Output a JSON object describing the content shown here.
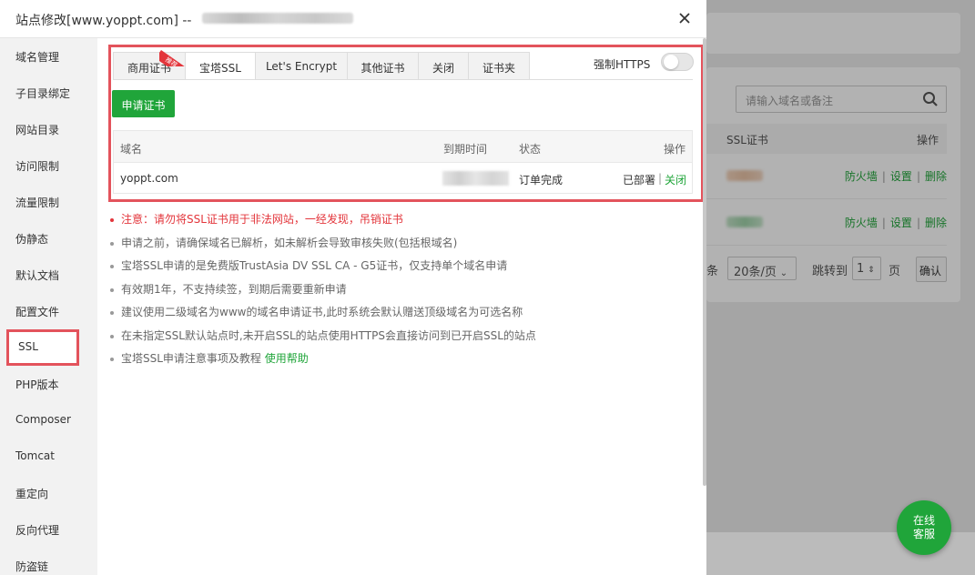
{
  "modal": {
    "title": "站点修改[www.yoppt.com] --",
    "close_icon": "close-icon"
  },
  "sidebar": {
    "items": [
      {
        "label": "域名管理"
      },
      {
        "label": "子目录绑定"
      },
      {
        "label": "网站目录"
      },
      {
        "label": "访问限制"
      },
      {
        "label": "流量限制"
      },
      {
        "label": "伪静态"
      },
      {
        "label": "默认文档"
      },
      {
        "label": "配置文件"
      },
      {
        "label": "SSL",
        "active": true
      },
      {
        "label": "PHP版本"
      },
      {
        "label": "Composer"
      },
      {
        "label": "Tomcat"
      },
      {
        "label": "重定向"
      },
      {
        "label": "反向代理"
      },
      {
        "label": "防盗链"
      }
    ]
  },
  "ssl": {
    "tabs": [
      {
        "label": "商用证书"
      },
      {
        "label": "宝塔SSL",
        "active": true
      },
      {
        "label": "Let's Encrypt"
      },
      {
        "label": "其他证书"
      },
      {
        "label": "关闭"
      },
      {
        "label": "证书夹"
      }
    ],
    "ribbon": "推荐",
    "force_https_label": "强制HTTPS",
    "force_https_on": false,
    "apply_button": "申请证书",
    "table": {
      "headers": {
        "domain": "域名",
        "expiry": "到期时间",
        "status": "状态",
        "action": "操作"
      },
      "rows": [
        {
          "domain": "yoppt.com",
          "status": "订单完成",
          "deployed": "已部署",
          "sep": "|",
          "close": "关闭"
        }
      ]
    },
    "notes": {
      "n1": "注意：请勿将SSL证书用于非法网站，一经发现，吊销证书",
      "n2": "申请之前，请确保域名已解析，如未解析会导致审核失败(包括根域名)",
      "n3": "宝塔SSL申请的是免费版TrustAsia DV SSL CA - G5证书，仅支持单个域名申请",
      "n4": "有效期1年，不支持续签，到期后需要重新申请",
      "n5": "建议使用二级域名为www的域名申请证书,此时系统会默认赠送顶级域名为可选名称",
      "n6": "在未指定SSL默认站点时,未开启SSL的站点使用HTTPS会直接访问到已开启SSL的站点",
      "n7_text": "宝塔SSL申请注意事项及教程",
      "n7_link": "使用帮助"
    }
  },
  "background": {
    "search_placeholder": "请输入域名或备注",
    "col_ssl": "SSL证书",
    "col_action": "操作",
    "row_ops": {
      "firewall": "防火墙",
      "sep": "|",
      "settings": "设置",
      "delete": "删除"
    },
    "pager": {
      "unit": "条",
      "per_page": "20条/页",
      "jump_label": "跳转到",
      "page_num": "1",
      "page_unit": "页",
      "confirm": "确认"
    },
    "chat_line1": "在线",
    "chat_line2": "客服"
  },
  "colors": {
    "accent_green": "#20a53a",
    "highlight_red": "#e3535c",
    "warning_red": "#e3353b"
  }
}
